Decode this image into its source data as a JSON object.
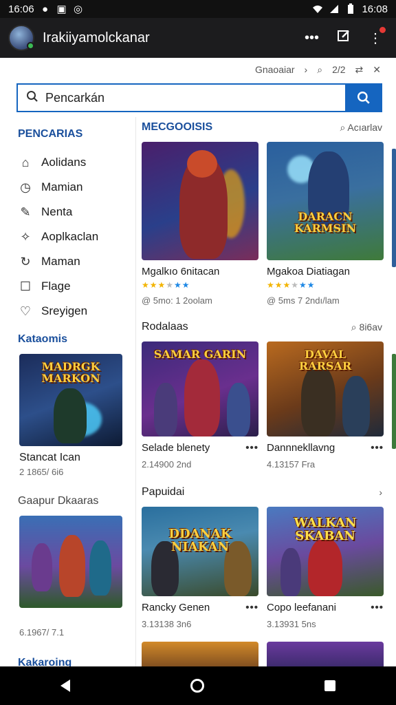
{
  "status_bar": {
    "time_left": "16:06",
    "time_right": "16:08"
  },
  "app_bar": {
    "title": "Irakiiyamolckanar"
  },
  "top_bar": {
    "label": "Gnaoaiar",
    "chev": "›",
    "num": "2/2"
  },
  "search": {
    "placeholder": "Pencarkán"
  },
  "sidebar": {
    "heading": "PENCARIAS",
    "items": [
      {
        "icon": "home-icon",
        "glyph": "⌂",
        "label": "Aolidans"
      },
      {
        "icon": "clock-icon",
        "glyph": "◷",
        "label": "Mamian"
      },
      {
        "icon": "puzzle-icon",
        "glyph": "✎",
        "label": "Nenta"
      },
      {
        "icon": "apps-icon",
        "glyph": "✧",
        "label": "Aoplkaclan"
      },
      {
        "icon": "refresh-icon",
        "glyph": "↻",
        "label": "Maman"
      },
      {
        "icon": "flag-icon",
        "glyph": "☐",
        "label": "Flage"
      },
      {
        "icon": "heart-icon",
        "glyph": "♡",
        "label": "Sreyigen"
      }
    ],
    "section1": "Kataomis",
    "card1": {
      "name": "Stancat Ican",
      "meta": "2 1865/ 6i6",
      "art": "MADRGK MARKON"
    },
    "section2": "Gaapur Dkaaras",
    "card2": {
      "name": "",
      "meta": "6.1967/ 7.1",
      "art": ""
    },
    "section3": "Kakaroing"
  },
  "main": {
    "section1": {
      "title": "MECGOOISIS",
      "more": "Acıarlav"
    },
    "row1": [
      {
        "name": "Mgalkıo 6nitacan",
        "meta": "@ 5mo: 1 2oolam",
        "art": ""
      },
      {
        "name": "Mgakoa Diatiagan",
        "meta": "@ 5ms 7 2ndı/lam",
        "art": "DARACN KARMSIN"
      }
    ],
    "section2": {
      "title": "Rodalaas",
      "more": "8i6av"
    },
    "row2": [
      {
        "name": "Selade blenety",
        "meta": "2.14900 2nd",
        "art": "SAMAR GARIN"
      },
      {
        "name": "Dannnekllavng",
        "meta": "4.13157 Fra",
        "art": "DAVAL RARSAR"
      }
    ],
    "section3": {
      "title": "Papuidai",
      "more": "›"
    },
    "row3": [
      {
        "name": "Rancky Genen",
        "meta": "3.13138 3n6",
        "art": "DDANAK NIAKAN"
      },
      {
        "name": "Copo leefanani",
        "meta": "3.13931 5ns",
        "art": "WALKAN SKABAN"
      }
    ]
  },
  "colors": {
    "accent": "#1565c0",
    "heading": "#1a4f9c",
    "star": "#f2b400"
  }
}
